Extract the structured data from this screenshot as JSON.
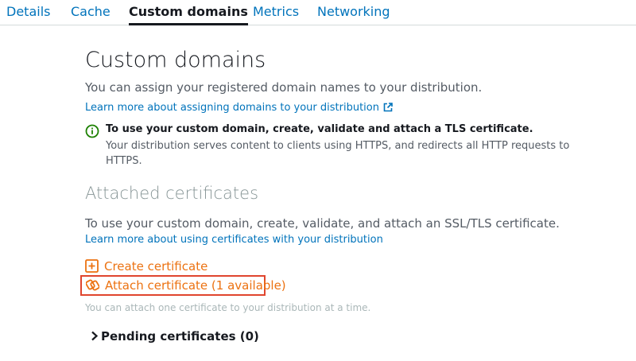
{
  "tabs": [
    {
      "label": "Details",
      "active": false
    },
    {
      "label": "Cache",
      "active": false
    },
    {
      "label": "Custom domains",
      "active": true
    },
    {
      "label": "Metrics",
      "active": false
    },
    {
      "label": "Networking",
      "active": false
    }
  ],
  "custom_domains": {
    "title": "Custom domains",
    "description": "You can assign your registered domain names to your distribution.",
    "learn_more_link": "Learn more about assigning domains to your distribution"
  },
  "info_alert": {
    "title": "To use your custom domain, create, validate and attach a TLS certificate.",
    "body_line1": "Your distribution serves content to clients using HTTPS, and redirects all HTTP requests to",
    "body_line2": "HTTPS."
  },
  "attached_certificates": {
    "title": "Attached certificates",
    "description": "To use your custom domain, create, validate, and attach an SSL/TLS certificate.",
    "learn_more_link": "Learn more about using certificates with your distribution",
    "create_label": "Create certificate",
    "attach_label": "Attach certificate (1 available)",
    "note": "You can attach one certificate to your distribution at a time.",
    "pending_label": "Pending certificates (0)"
  },
  "colors": {
    "link": "#0073bb",
    "action": "#ec7211",
    "highlight": "#e0452e",
    "success": "#1d8102"
  }
}
